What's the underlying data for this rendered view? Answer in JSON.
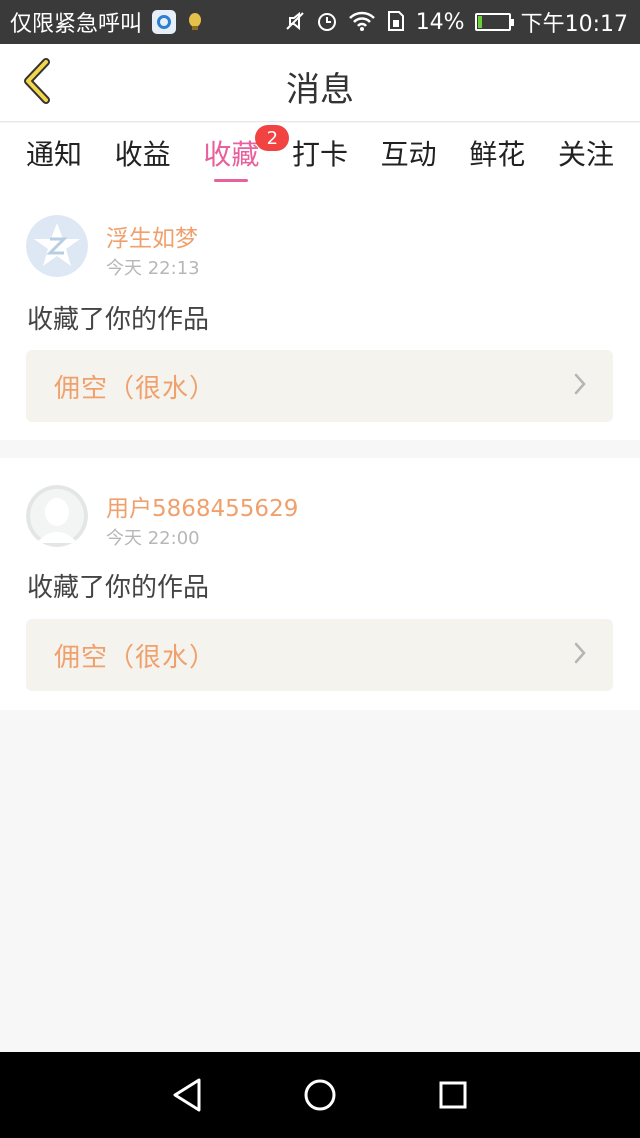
{
  "status_bar": {
    "left_text": "仅限紧急呼叫",
    "battery": "14%",
    "battery_level": 0.14,
    "time": "下午10:17",
    "icons": [
      "app-icon",
      "notification-icon",
      "mute-icon",
      "alarm-icon",
      "wifi-icon",
      "sim-icon",
      "battery-icon"
    ]
  },
  "header": {
    "title": "消息",
    "back_icon": "chevron-left-icon"
  },
  "tabs": [
    {
      "label": "通知"
    },
    {
      "label": "收益"
    },
    {
      "label": "收藏",
      "active": true,
      "badge": "2"
    },
    {
      "label": "打卡"
    },
    {
      "label": "互动"
    },
    {
      "label": "鲜花"
    },
    {
      "label": "关注"
    }
  ],
  "messages": [
    {
      "username": "浮生如梦",
      "time": "今天 22:13",
      "action": "收藏了你的作品",
      "work_title": "佣空（很水）",
      "avatar": "qq-avatar-icon"
    },
    {
      "username": "用户5868455629",
      "time": "今天 22:00",
      "action": "收藏了你的作品",
      "work_title": "佣空（很水）",
      "avatar": "default-avatar-icon"
    }
  ],
  "colors": {
    "accent_tab": "#e8609c",
    "username": "#f0a06c",
    "badge": "#f24343"
  },
  "nav": [
    "back-triangle-icon",
    "home-circle-icon",
    "recents-square-icon"
  ]
}
